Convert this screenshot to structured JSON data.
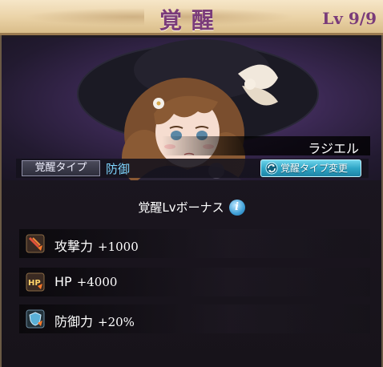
{
  "header": {
    "title": "覚醒",
    "level": "Lv 9/9"
  },
  "character": {
    "name": "ラジエル"
  },
  "awakening_type": {
    "label": "覚醒タイプ",
    "value": "防御",
    "change_button": "覚醒タイプ変更"
  },
  "bonus": {
    "title": "覚醒Lvボーナス",
    "info_glyph": "i",
    "items": [
      {
        "stat": "攻撃力",
        "value": "+1000",
        "icon": "attack-sword-icon"
      },
      {
        "stat": "HP",
        "value": "+4000",
        "icon": "hp-icon"
      },
      {
        "stat": "防御力",
        "value": "+20%",
        "icon": "defense-shield-icon"
      }
    ]
  },
  "colors": {
    "title": "#7a3b7a",
    "type_value": "#7fd6ff",
    "change_button": "#2fa6c6"
  }
}
